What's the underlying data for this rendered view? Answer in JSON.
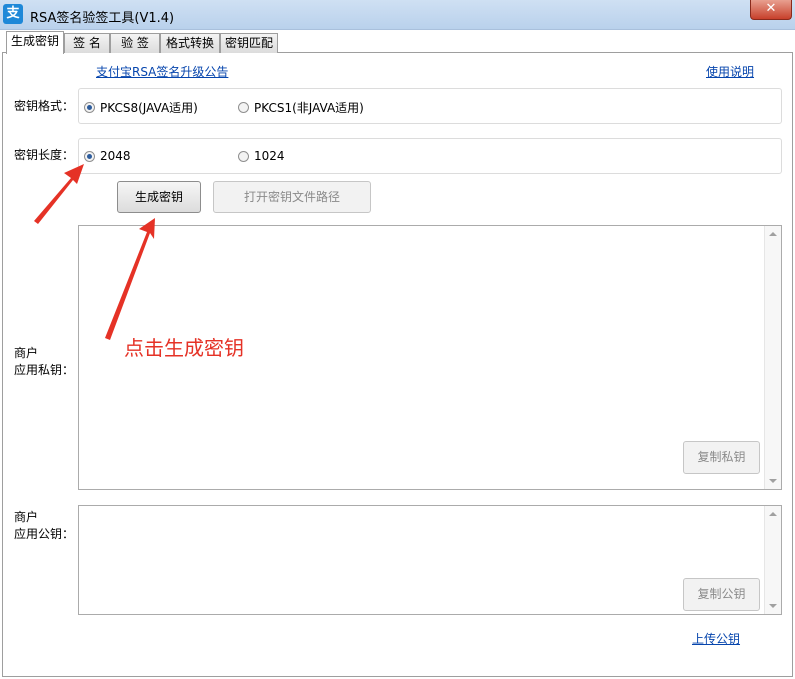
{
  "window": {
    "title": "RSA签名验签工具(V1.4)",
    "app_icon_glyph": "支",
    "close_glyph": "✕"
  },
  "tabs": [
    {
      "label": "生成密钥",
      "active": true
    },
    {
      "label": "签  名",
      "active": false
    },
    {
      "label": "验  签",
      "active": false
    },
    {
      "label": "格式转换",
      "active": false
    },
    {
      "label": "密钥匹配",
      "active": false
    }
  ],
  "links": {
    "announcement": "支付宝RSA签名升级公告",
    "help": "使用说明",
    "upload_public_key": "上传公钥"
  },
  "key_format": {
    "label": "密钥格式：",
    "options": [
      {
        "label": "PKCS8(JAVA适用)",
        "checked": true
      },
      {
        "label": "PKCS1(非JAVA适用)",
        "checked": false
      }
    ]
  },
  "key_length": {
    "label": "密钥长度：",
    "options": [
      {
        "label": "2048",
        "checked": true
      },
      {
        "label": "1024",
        "checked": false
      }
    ]
  },
  "buttons": {
    "generate": "生成密钥",
    "open_path": "打开密钥文件路径",
    "copy_private": "复制私钥",
    "copy_public": "复制公钥"
  },
  "private_key": {
    "label_line1": "商户",
    "label_line2": "应用私钥：",
    "value": ""
  },
  "public_key": {
    "label_line1": "商户",
    "label_line2": "应用公钥：",
    "value": ""
  },
  "annotation": {
    "text": "点击生成密钥",
    "color": "#e53226"
  }
}
